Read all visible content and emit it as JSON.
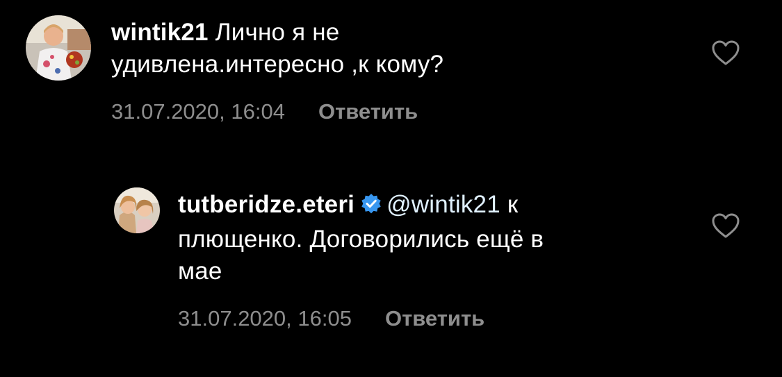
{
  "comments": [
    {
      "username": "wintik21",
      "text": "Лично я не удивлена.интересно ,к кому?",
      "line1": "Лично я не",
      "line2": "удивлена.интересно ,к кому?",
      "timestamp": "31.07.2020, 16:04",
      "reply_label": "Ответить",
      "avatar": "user-photo-avatar",
      "like_icon": "heart-outline-icon"
    },
    {
      "username": "tutberidze.eteri",
      "verified": true,
      "mention": "@wintik21",
      "text": "к плющенко. Договорились ещё в мае",
      "line1_tail": "к",
      "line2": "плющенко. Договорились ещё в",
      "line3": "мае",
      "timestamp": "31.07.2020, 16:05",
      "reply_label": "Ответить",
      "avatar": "user-photo-avatar",
      "like_icon": "heart-outline-icon"
    }
  ],
  "colors": {
    "background": "#000000",
    "text": "#ffffff",
    "muted": "#8e8e8e",
    "mention": "#e0f1ff",
    "verified_badge": "#3897f0"
  }
}
